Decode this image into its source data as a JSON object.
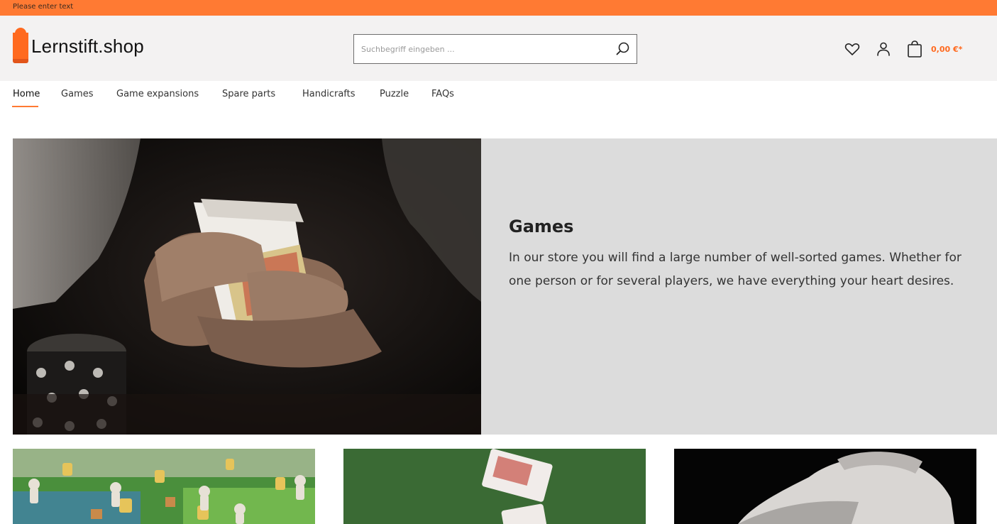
{
  "topbar": {
    "text": "Please enter text"
  },
  "header": {
    "logo_text": "Lernstift.shop",
    "search": {
      "placeholder": "Suchbegriff eingeben ...",
      "value": ""
    },
    "cart_total": "0,00 €*",
    "icons": [
      "heart-icon",
      "user-icon",
      "bag-icon",
      "search-icon"
    ]
  },
  "nav": {
    "items": [
      {
        "label": "Home",
        "active": true
      },
      {
        "label": "Games"
      },
      {
        "label": "Game expansions"
      },
      {
        "label": "Spare parts"
      },
      {
        "label": "Handicrafts"
      },
      {
        "label": "Puzzle"
      },
      {
        "label": "FAQs"
      }
    ]
  },
  "hero": {
    "title": "Games",
    "description": "In our store you will find a large number of well-sorted games. Whether for one person or for several players, we have everything your heart desires."
  },
  "colors": {
    "accent": "#ff7a33",
    "header_bg": "#f3f2f2",
    "hero_bg": "#dcdcdc"
  }
}
